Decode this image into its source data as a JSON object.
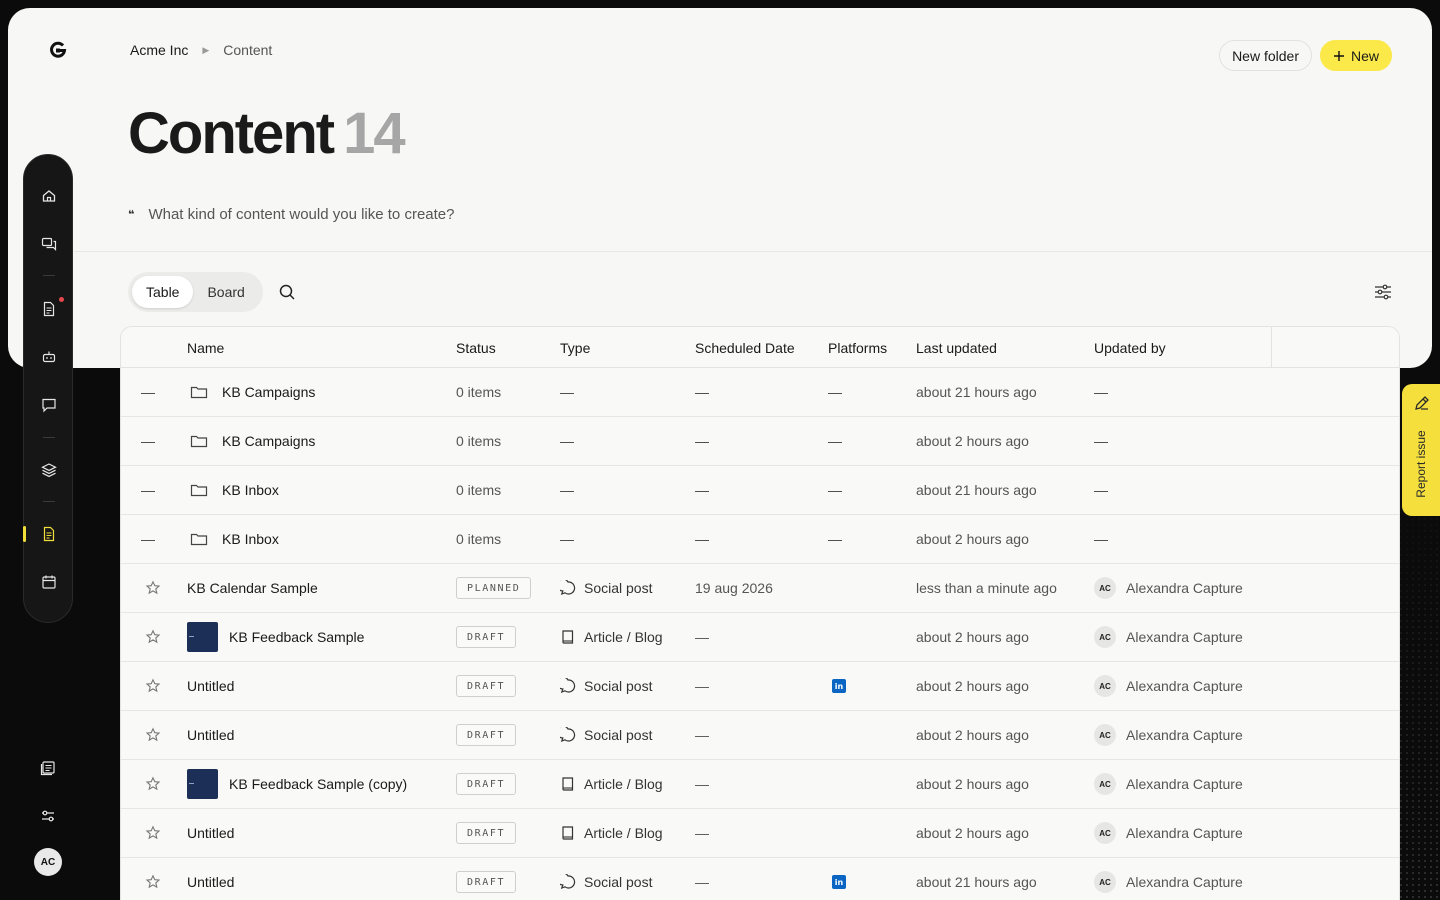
{
  "breadcrumb": {
    "org": "Acme Inc",
    "current": "Content"
  },
  "actions": {
    "new_folder": "New folder",
    "new": "New"
  },
  "page": {
    "title": "Content",
    "count": "14"
  },
  "prompt": {
    "placeholder": "What kind of content would you like to create?"
  },
  "view_toggle": {
    "table": "Table",
    "board": "Board",
    "active": "Table"
  },
  "table": {
    "headers": {
      "name": "Name",
      "status": "Status",
      "type": "Type",
      "scheduled": "Scheduled Date",
      "platforms": "Platforms",
      "last_updated": "Last updated",
      "updated_by": "Updated by"
    },
    "rows": [
      {
        "kind": "folder",
        "name": "KB Campaigns",
        "status": "0 items",
        "type": "—",
        "scheduled": "—",
        "platforms": "—",
        "last_updated": "about 21 hours ago",
        "updated_by": "—"
      },
      {
        "kind": "folder",
        "name": "KB Campaigns",
        "status": "0 items",
        "type": "—",
        "scheduled": "—",
        "platforms": "—",
        "last_updated": "about 2 hours ago",
        "updated_by": "—"
      },
      {
        "kind": "folder",
        "name": "KB Inbox",
        "status": "0 items",
        "type": "—",
        "scheduled": "—",
        "platforms": "—",
        "last_updated": "about 21 hours ago",
        "updated_by": "—"
      },
      {
        "kind": "folder",
        "name": "KB Inbox",
        "status": "0 items",
        "type": "—",
        "scheduled": "—",
        "platforms": "—",
        "last_updated": "about 2 hours ago",
        "updated_by": "—"
      },
      {
        "kind": "item",
        "name": "KB Calendar Sample",
        "status": "PLANNED",
        "type": "Social post",
        "type_icon": "chat-bubble-icon",
        "scheduled": "19 aug 2026",
        "platforms": "",
        "last_updated": "less than a minute ago",
        "updated_by_initials": "AC",
        "updated_by": "Alexandra Capture"
      },
      {
        "kind": "item",
        "name": "KB Feedback Sample",
        "thumb": true,
        "status": "DRAFT",
        "type": "Article / Blog",
        "type_icon": "book-icon",
        "scheduled": "—",
        "platforms": "",
        "last_updated": "about 2 hours ago",
        "updated_by_initials": "AC",
        "updated_by": "Alexandra Capture"
      },
      {
        "kind": "item",
        "name": "Untitled",
        "status": "DRAFT",
        "type": "Social post",
        "type_icon": "chat-bubble-icon",
        "scheduled": "—",
        "platforms": "linkedin",
        "last_updated": "about 2 hours ago",
        "updated_by_initials": "AC",
        "updated_by": "Alexandra Capture"
      },
      {
        "kind": "item",
        "name": "Untitled",
        "status": "DRAFT",
        "type": "Social post",
        "type_icon": "chat-bubble-icon",
        "scheduled": "—",
        "platforms": "",
        "last_updated": "about 2 hours ago",
        "updated_by_initials": "AC",
        "updated_by": "Alexandra Capture"
      },
      {
        "kind": "item",
        "name": "KB Feedback Sample (copy)",
        "thumb": true,
        "status": "DRAFT",
        "type": "Article / Blog",
        "type_icon": "book-icon",
        "scheduled": "—",
        "platforms": "",
        "last_updated": "about 2 hours ago",
        "updated_by_initials": "AC",
        "updated_by": "Alexandra Capture"
      },
      {
        "kind": "item",
        "name": "Untitled",
        "status": "DRAFT",
        "type": "Article / Blog",
        "type_icon": "book-icon",
        "scheduled": "—",
        "platforms": "",
        "last_updated": "about 2 hours ago",
        "updated_by_initials": "AC",
        "updated_by": "Alexandra Capture"
      },
      {
        "kind": "item",
        "name": "Untitled",
        "status": "DRAFT",
        "type": "Social post",
        "type_icon": "chat-bubble-icon",
        "scheduled": "—",
        "platforms": "linkedin",
        "last_updated": "about 21 hours ago",
        "updated_by_initials": "AC",
        "updated_by": "Alexandra Capture"
      }
    ]
  },
  "sidebar": {
    "items": [
      {
        "name": "home-icon"
      },
      {
        "name": "messages-icon"
      },
      {
        "name": "document-icon",
        "badge": true
      },
      {
        "name": "robot-icon"
      },
      {
        "name": "chat-icon"
      },
      {
        "name": "layers-icon"
      },
      {
        "name": "content-icon",
        "active": true
      },
      {
        "name": "calendar-icon"
      }
    ],
    "bottom": [
      {
        "name": "library-icon"
      },
      {
        "name": "settings-sliders-icon"
      }
    ],
    "avatar": "AC"
  },
  "report": {
    "label": "Report issue"
  },
  "colors": {
    "accent": "#fbe94a",
    "report_tab": "#f4df3d",
    "linkedin": "#0a66c2",
    "badge_red": "#e5484d",
    "thumb": "#1b2f57"
  }
}
